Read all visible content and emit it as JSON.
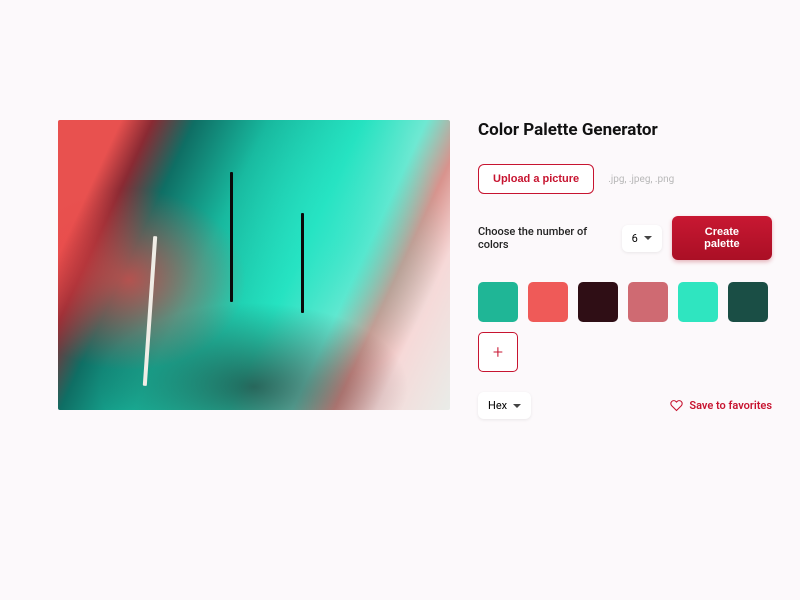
{
  "title": "Color Palette Generator",
  "upload": {
    "button_label": "Upload a picture",
    "file_types_hint": ".jpg, .jpeg, .png"
  },
  "count": {
    "label": "Choose the number of colors",
    "value": "6"
  },
  "create_button_label": "Create palette",
  "palette": [
    "#1fb696",
    "#ef5a58",
    "#2f0e15",
    "#cf6a72",
    "#2fe5c0",
    "#1a4e45"
  ],
  "format": {
    "value": "Hex"
  },
  "favorites": {
    "label": "Save to favorites"
  },
  "accent_color": "#c71430"
}
